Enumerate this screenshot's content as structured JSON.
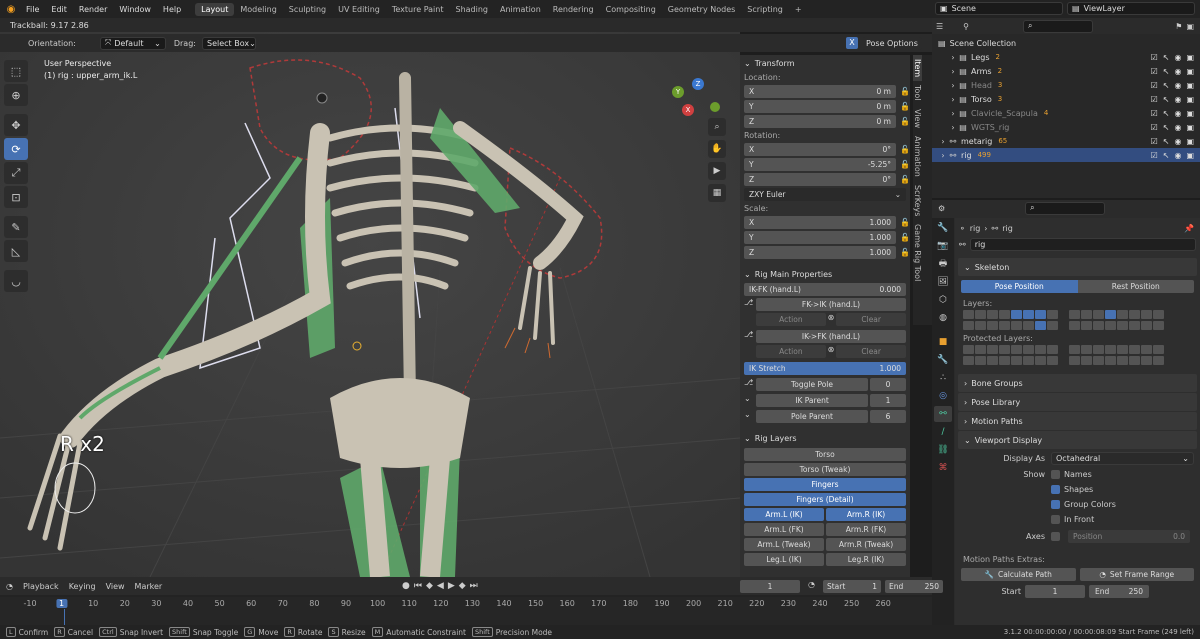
{
  "menu": [
    "File",
    "Edit",
    "Render",
    "Window",
    "Help"
  ],
  "workspaces": [
    "Layout",
    "Modeling",
    "Sculpting",
    "UV Editing",
    "Texture Paint",
    "Shading",
    "Animation",
    "Rendering",
    "Compositing",
    "Geometry Nodes",
    "Scripting"
  ],
  "add_tab": "+",
  "scene": "Scene",
  "view_layer": "ViewLayer",
  "trackball": "Trackball: 9.17 2.86",
  "orientation_label": "Orientation:",
  "orientation_value": "Default",
  "drag_label": "Drag:",
  "drag_value": "Select Box",
  "pose_options": "Pose Options",
  "x_toggle": "X",
  "viewport_info": {
    "line1": "User Perspective",
    "line2": "(1) rig : upper_arm_ik.L"
  },
  "overlay_text": "R x2",
  "tools": [
    "select",
    "cursor",
    "move",
    "rotate",
    "scale",
    "transform",
    "annotate",
    "measure",
    "relax"
  ],
  "nav_gizmo": {
    "y": "Y",
    "x": "X",
    "z": "Z"
  },
  "npanel": {
    "transform_title": "Transform",
    "location_label": "Location:",
    "location": [
      {
        "axis": "X",
        "value": "0 m"
      },
      {
        "axis": "Y",
        "value": "0 m"
      },
      {
        "axis": "Z",
        "value": "0 m"
      }
    ],
    "rotation_label": "Rotation:",
    "rotation": [
      {
        "axis": "X",
        "value": "0°"
      },
      {
        "axis": "Y",
        "value": "-5.25°"
      },
      {
        "axis": "Z",
        "value": "0°"
      }
    ],
    "rotation_mode": "ZXY Euler",
    "scale_label": "Scale:",
    "scale": [
      {
        "axis": "X",
        "value": "1.000"
      },
      {
        "axis": "Y",
        "value": "1.000"
      },
      {
        "axis": "Z",
        "value": "1.000"
      }
    ],
    "rig_main_title": "Rig Main Properties",
    "ikfk_label": "IK-FK (hand.L)",
    "ikfk_value": "0.000",
    "fk_ik_btn": "FK->IK (hand.L)",
    "ik_fk_btn": "IK->FK (hand.L)",
    "action": "Action",
    "clear": "Clear",
    "ik_stretch_label": "IK Stretch",
    "ik_stretch_value": "1.000",
    "toggle_pole_label": "Toggle Pole",
    "toggle_pole_value": "0",
    "ik_parent_label": "IK Parent",
    "ik_parent_value": "1",
    "pole_parent_label": "Pole Parent",
    "pole_parent_value": "6",
    "rig_layers_title": "Rig Layers",
    "layers": [
      {
        "cols": [
          {
            "label": "Torso",
            "on": false
          }
        ]
      },
      {
        "cols": [
          {
            "label": "Torso (Tweak)",
            "on": false
          }
        ]
      },
      {
        "cols": [
          {
            "label": "Fingers",
            "on": true
          }
        ]
      },
      {
        "cols": [
          {
            "label": "Fingers (Detail)",
            "on": true
          }
        ]
      },
      {
        "cols": [
          {
            "label": "Arm.L (IK)",
            "on": true
          },
          {
            "label": "Arm.R (IK)",
            "on": true
          }
        ]
      },
      {
        "cols": [
          {
            "label": "Arm.L (FK)",
            "on": false
          },
          {
            "label": "Arm.R (FK)",
            "on": false
          }
        ]
      },
      {
        "cols": [
          {
            "label": "Arm.L (Tweak)",
            "on": false
          },
          {
            "label": "Arm.R (Tweak)",
            "on": false
          }
        ]
      },
      {
        "cols": [
          {
            "label": "Leg.L (IK)",
            "on": false
          },
          {
            "label": "Leg.R (IK)",
            "on": false
          }
        ]
      }
    ]
  },
  "vtabs": [
    "Item",
    "Tool",
    "View",
    "Animation",
    "ScrKeys",
    "Game Rig Tool"
  ],
  "outliner": {
    "root": "Scene Collection",
    "items": [
      {
        "name": "Legs",
        "badge": "2",
        "indent": 1,
        "dim": false,
        "sel": false
      },
      {
        "name": "Arms",
        "badge": "2",
        "indent": 1,
        "dim": false,
        "sel": false
      },
      {
        "name": "Head",
        "badge": "3",
        "indent": 1,
        "dim": true,
        "sel": false
      },
      {
        "name": "Torso",
        "badge": "3",
        "indent": 1,
        "dim": false,
        "sel": false
      },
      {
        "name": "Clavicle_Scapula",
        "badge": "4",
        "indent": 1,
        "dim": true,
        "sel": false
      },
      {
        "name": "WGTS_rig",
        "badge": "",
        "indent": 1,
        "dim": true,
        "sel": false
      },
      {
        "name": "metarig",
        "badge": "65",
        "indent": 0,
        "dim": false,
        "sel": false
      },
      {
        "name": "rig",
        "badge": "499",
        "indent": 0,
        "dim": false,
        "sel": true
      }
    ]
  },
  "props": {
    "breadcrumb": [
      "rig",
      "rig"
    ],
    "name_field": "rig",
    "skeleton_title": "Skeleton",
    "pose_position": "Pose Position",
    "rest_position": "Rest Position",
    "layers_label": "Layers:",
    "protected_label": "Protected Layers:",
    "bone_groups": "Bone Groups",
    "pose_library": "Pose Library",
    "motion_paths": "Motion Paths",
    "viewport_display": "Viewport Display",
    "display_as_label": "Display As",
    "display_as_value": "Octahedral",
    "show_label": "Show",
    "show_items": [
      {
        "label": "Names",
        "on": false
      },
      {
        "label": "Shapes",
        "on": true
      },
      {
        "label": "Group Colors",
        "on": true
      },
      {
        "label": "In Front",
        "on": false
      }
    ],
    "axes_label": "Axes",
    "position_label": "Position",
    "position_value": "0.0",
    "mpe_title": "Motion Paths Extras:",
    "calc_path": "Calculate Path",
    "set_frame_range": "Set Frame Range",
    "start_label": "Start",
    "start_value": "1",
    "end_label": "End",
    "end_value": "250"
  },
  "timeline": {
    "menus": [
      "Playback",
      "Keying",
      "View",
      "Marker"
    ],
    "current_frame": "1",
    "start_label": "Start",
    "start": "1",
    "end_label": "End",
    "end": "250",
    "ruler": [
      "-10",
      "1",
      "10",
      "20",
      "30",
      "40",
      "50",
      "60",
      "70",
      "80",
      "90",
      "100",
      "110",
      "120",
      "130",
      "140",
      "150",
      "160",
      "170",
      "180",
      "190",
      "200",
      "210",
      "220",
      "230",
      "240",
      "250",
      "260"
    ]
  },
  "status": {
    "items": [
      {
        "key": "L",
        "label": "Confirm"
      },
      {
        "key": "R",
        "label": "Cancel"
      },
      {
        "key": "Ctrl",
        "label": "Snap Invert"
      },
      {
        "key": "Shift",
        "label": "Snap Toggle"
      },
      {
        "key": "G",
        "label": "Move"
      },
      {
        "key": "R",
        "label": "Rotate"
      },
      {
        "key": "S",
        "label": "Resize"
      },
      {
        "key": "M",
        "label": "Automatic Constraint"
      },
      {
        "key": "Shift",
        "label": "Precision Mode"
      }
    ],
    "right": "3.1.2   00:00:00:00 / 00:00:08:09   Start Frame (249 left)"
  },
  "colors": {
    "accent": "#4772b3",
    "bone": "#c9c2b3",
    "shape": "#5fa86a",
    "red": "#d04040"
  }
}
